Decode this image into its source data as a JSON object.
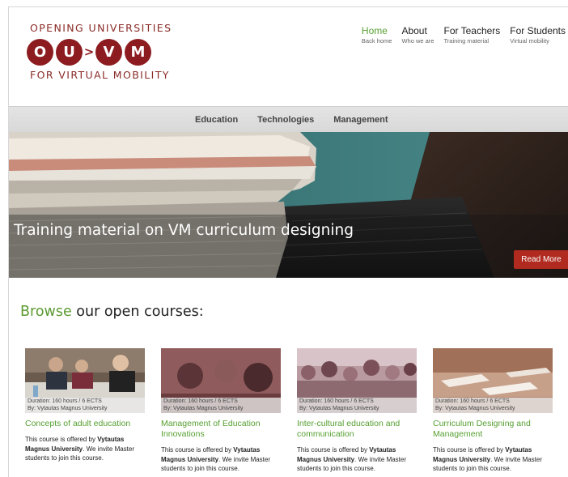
{
  "logo": {
    "top": "OPENING UNIVERSITIES",
    "letters": [
      "O",
      "U",
      "V",
      "M"
    ],
    "arrow": ">",
    "bottom": "FOR VIRTUAL MOBILITY"
  },
  "topnav": [
    {
      "title": "Home",
      "subtitle": "Back home",
      "active": true
    },
    {
      "title": "About",
      "subtitle": "Who we are",
      "active": false
    },
    {
      "title": "For Teachers",
      "subtitle": "Training material",
      "active": false
    },
    {
      "title": "For Students",
      "subtitle": "Virtual mobility",
      "active": false
    }
  ],
  "subnav": [
    "Education",
    "Technologies",
    "Management"
  ],
  "hero": {
    "title": "Training material on VM curriculum designing",
    "button": "Read More"
  },
  "browse": {
    "highlight": "Browse",
    "rest": " our open courses:"
  },
  "courses": [
    {
      "duration": "Duration: 160 hours / 6 ECTS",
      "by": "By: Vytautas Magnus University",
      "title": "Concepts of adult education",
      "desc_a": "This course is offered by ",
      "desc_b": "Vytautas Magnus University",
      "desc_c": ". We invite Master students to join this course."
    },
    {
      "duration": "Duration: 160 hours / 6 ECTS",
      "by": "By: Vytautas Magnus University",
      "title": "Management of Education Innovations",
      "desc_a": "This course is offered by ",
      "desc_b": "Vytautas Magnus University",
      "desc_c": ". We invite Master students to join this course."
    },
    {
      "duration": "Duration: 160 hours / 6 ECTS",
      "by": "By: Vytautas Magnus University",
      "title": "Inter-cultural education and communication",
      "desc_a": "This course is offered by ",
      "desc_b": "Vytautas Magnus University",
      "desc_c": ". We invite Master students to join this course."
    },
    {
      "duration": "Duration: 160 hours / 6 ECTS",
      "by": "By: Vytautas Magnus University",
      "title": "Curriculum Designing and Management",
      "desc_a": "This course is offered by ",
      "desc_b": "Vytautas Magnus University",
      "desc_c": ". We invite Master students to join this course."
    }
  ],
  "colors": {
    "brand": "#8c1c1f",
    "accent_green": "#57a032",
    "button_red": "#b02a1f"
  }
}
